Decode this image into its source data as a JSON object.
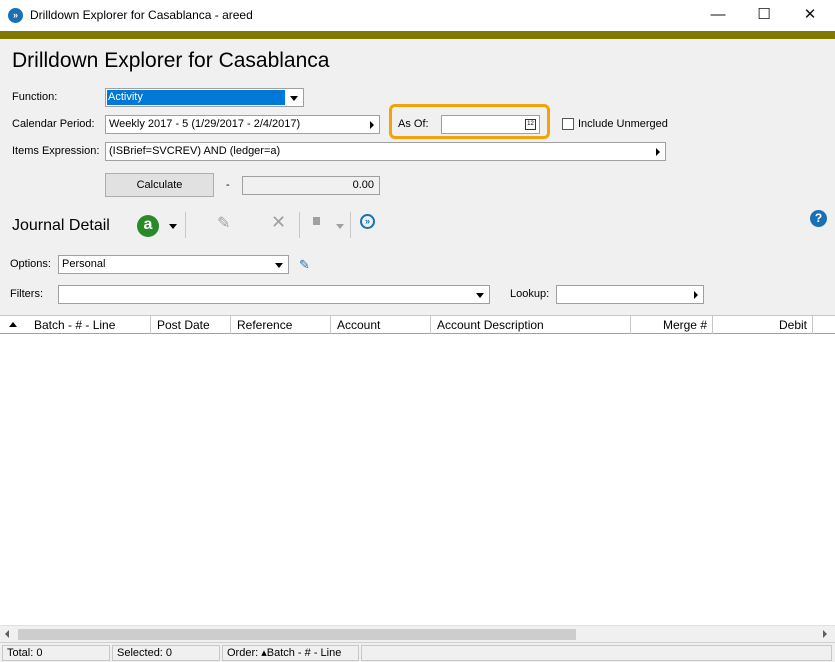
{
  "window": {
    "title": "Drilldown Explorer for Casablanca - areed",
    "minimize": "—",
    "maximize": "☐",
    "close": "✕"
  },
  "main": {
    "title": "Drilldown Explorer for Casablanca",
    "function_label": "Function:",
    "function_value": "Activity",
    "calendar_label": "Calendar Period:",
    "calendar_value": "Weekly 2017 - 5   (1/29/2017 - 2/4/2017)",
    "asof_label": "As Of:",
    "asof_value": "",
    "unmerged_label": "Include Unmerged",
    "items_label": "Items Expression:",
    "items_value": "(ISBrief=SVCREV) AND (ledger=a)",
    "calculate_label": "Calculate",
    "dash": "-",
    "calc_value": "0.00"
  },
  "journal": {
    "title": "Journal Detail",
    "a_icon_letter": "a",
    "options_label": "Options:",
    "options_value": "Personal",
    "filters_label": "Filters:",
    "filters_value": "",
    "lookup_label": "Lookup:",
    "lookup_value": "",
    "help": "?"
  },
  "grid": {
    "columns": [
      "Batch - # - Line",
      "Post Date",
      "Reference",
      "Account",
      "Account Description",
      "Merge #",
      "Debit"
    ]
  },
  "status": {
    "total": "Total: 0",
    "selected": "Selected: 0",
    "order": "Order: ▴Batch - # - Line"
  },
  "colors": {
    "accent": "#807800",
    "highlight": "#f5a10c",
    "selection": "#0078d7"
  }
}
